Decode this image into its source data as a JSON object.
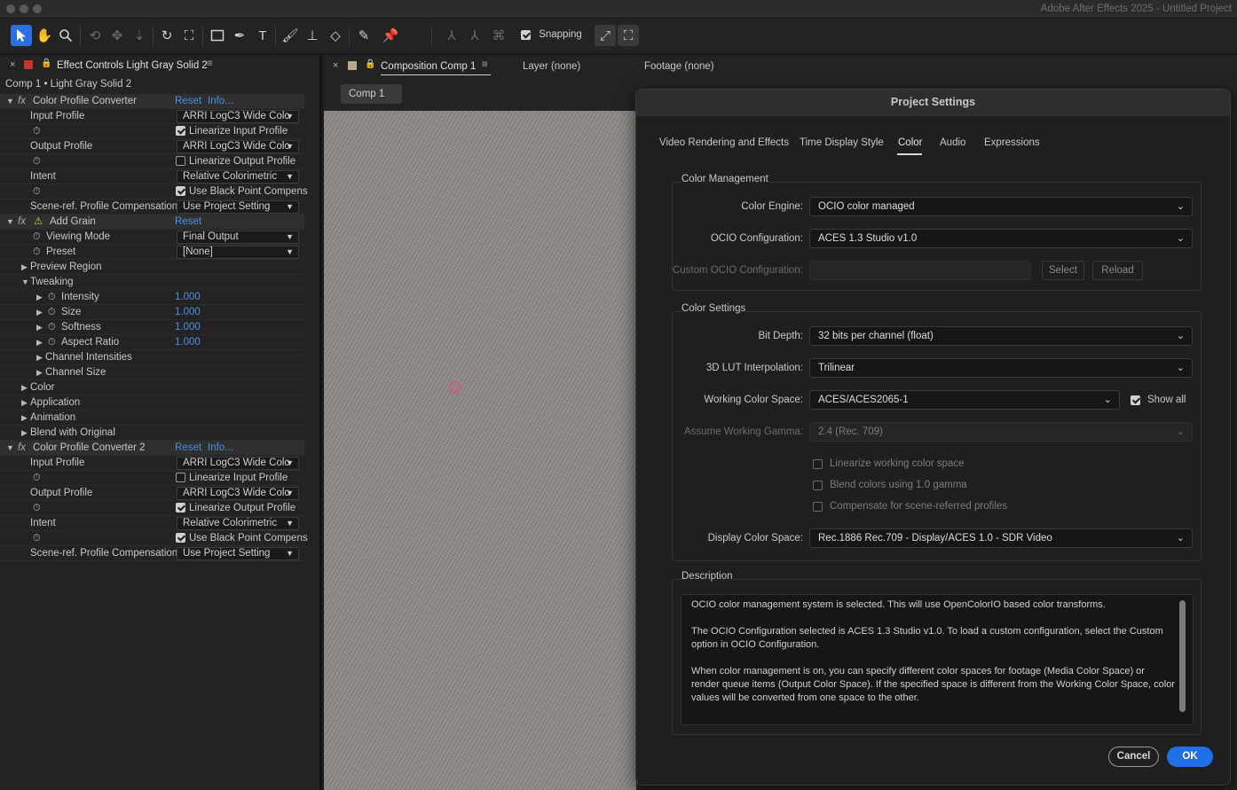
{
  "app": {
    "title": "Adobe After Effects 2025 - Untitled Project"
  },
  "toolbar": {
    "snapping_label": "Snapping",
    "snapping_checked": true
  },
  "left_panel": {
    "tab_label": "Effect Controls Light Gray Solid 2",
    "breadcrumb": "Comp 1 • Light Gray Solid 2",
    "effect1": {
      "name": "Color Profile Converter",
      "reset": "Reset",
      "info": "Info...",
      "input_profile_label": "Input Profile",
      "input_profile_value": "ARRI LogC3 Wide Colc",
      "linearize_input_label": "Linearize Input Profile",
      "output_profile_label": "Output Profile",
      "output_profile_value": "ARRI LogC3 Wide Colc",
      "linearize_output_label": "Linearize Output Profile",
      "intent_label": "Intent",
      "intent_value": "Relative Colorimetric",
      "black_point_label": "Use Black Point Compens",
      "scene_ref_label": "Scene-ref. Profile Compensation",
      "scene_ref_value": "Use Project Setting"
    },
    "effect2": {
      "name": "Add Grain",
      "reset": "Reset",
      "viewing_mode_label": "Viewing Mode",
      "viewing_mode_value": "Final Output",
      "preset_label": "Preset",
      "preset_value": "[None]",
      "preview_region_label": "Preview Region",
      "tweaking_label": "Tweaking",
      "intensity_label": "Intensity",
      "intensity_value": "1.000",
      "size_label": "Size",
      "size_value": "1.000",
      "softness_label": "Softness",
      "softness_value": "1.000",
      "aspect_label": "Aspect Ratio",
      "aspect_value": "1.000",
      "channel_intensities_label": "Channel Intensities",
      "channel_size_label": "Channel Size",
      "color_label": "Color",
      "application_label": "Application",
      "animation_label": "Animation",
      "blend_label": "Blend with Original"
    },
    "effect3": {
      "name": "Color Profile Converter 2",
      "reset": "Reset",
      "info": "Info...",
      "input_profile_label": "Input Profile",
      "input_profile_value": "ARRI LogC3 Wide Colc",
      "linearize_input_label": "Linearize Input Profile",
      "output_profile_label": "Output Profile",
      "output_profile_value": "ARRI LogC3 Wide Colc",
      "linearize_output_label": "Linearize Output Profile",
      "intent_label": "Intent",
      "intent_value": "Relative Colorimetric",
      "black_point_label": "Use Black Point Compens",
      "scene_ref_label": "Scene-ref. Profile Compensation",
      "scene_ref_value": "Use Project Setting"
    }
  },
  "comp_panel": {
    "tab_composition": "Composition Comp 1",
    "tab_layer": "Layer (none)",
    "tab_footage": "Footage (none)",
    "comp_chip": "Comp 1"
  },
  "dialog": {
    "title": "Project Settings",
    "tabs": [
      "Video Rendering and Effects",
      "Time Display Style",
      "Color",
      "Audio",
      "Expressions"
    ],
    "color_management": {
      "title": "Color Management",
      "engine_label": "Color Engine:",
      "engine_value": "OCIO color managed",
      "ocio_label": "OCIO Configuration:",
      "ocio_value": "ACES 1.3 Studio v1.0",
      "custom_label": "Custom OCIO Configuration:",
      "custom_value": "",
      "select_label": "Select",
      "reload_label": "Reload"
    },
    "color_settings": {
      "title": "Color Settings",
      "bit_depth_label": "Bit Depth:",
      "bit_depth_value": "32 bits per channel (float)",
      "lut_label": "3D LUT Interpolation:",
      "lut_value": "Trilinear",
      "working_label": "Working Color Space:",
      "working_value": "ACES/ACES2065-1",
      "show_all_label": "Show all",
      "gamma_label": "Assume Working Gamma:",
      "gamma_value": "2.4 (Rec. 709)",
      "linearize_label": "Linearize working color space",
      "blend_label": "Blend colors using 1.0 gamma",
      "compensate_label": "Compensate for scene-referred profiles",
      "display_label": "Display Color Space:",
      "display_value": "Rec.1886 Rec.709 - Display/ACES 1.0 - SDR Video"
    },
    "description": {
      "title": "Description",
      "p1": "OCIO color management system is selected. This will use OpenColorIO based color transforms.",
      "p2": "The OCIO Configuration selected is ACES 1.3 Studio v1.0. To load a custom configuration, select the Custom option in OCIO Configuration.",
      "p3": "When color management is on, you can specify different color spaces for footage (Media Color Space) or render queue items (Output Color Space). If the specified space is different from the Working Color Space, color values will be converted from one space to the other."
    },
    "cancel_label": "Cancel",
    "ok_label": "OK"
  }
}
